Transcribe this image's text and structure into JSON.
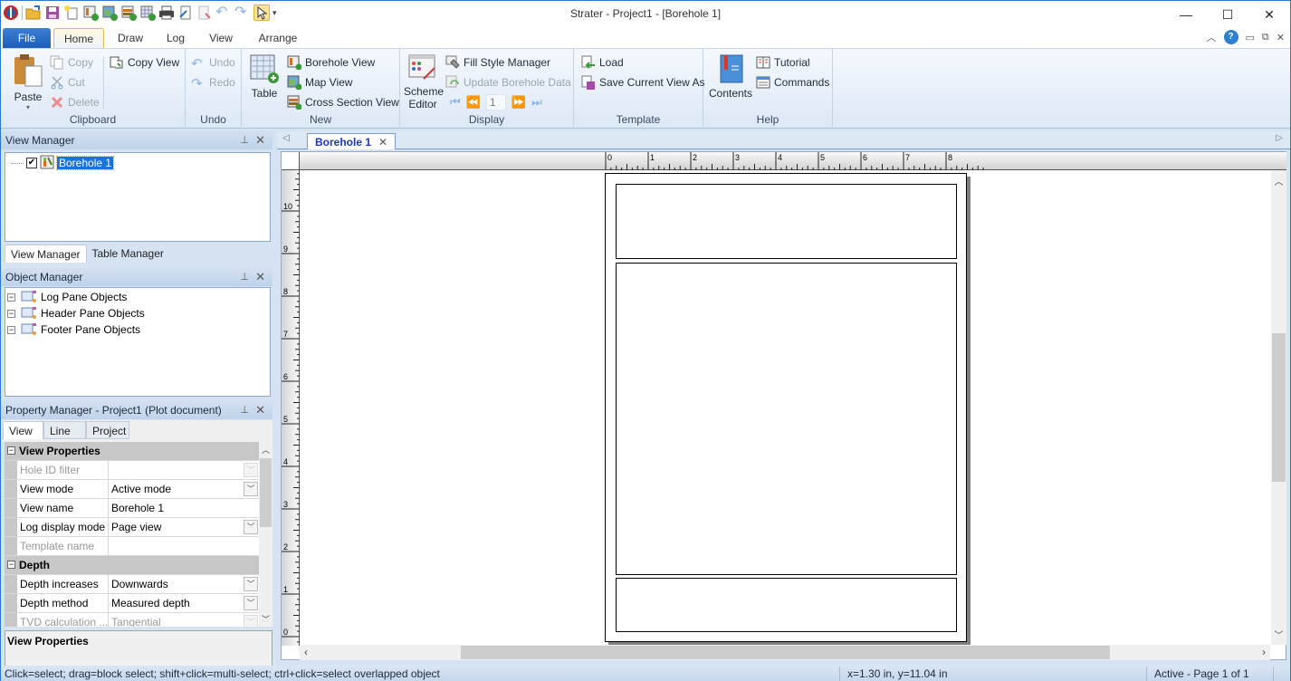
{
  "window": {
    "title": "Strater - Project1 - [Borehole 1]",
    "minimize": "—",
    "maximize": "☐",
    "close": "✕"
  },
  "quick_access": [
    "app-menu",
    "open",
    "save",
    "new",
    "new-borehole-view",
    "new-map-view",
    "new-cross-section-view",
    "new-table",
    "print",
    "export",
    "import",
    "undo",
    "redo",
    "select",
    "customize"
  ],
  "ribbon_tabs": [
    "File",
    "Home",
    "Draw",
    "Log",
    "View",
    "Arrange"
  ],
  "active_ribbon_tab": "Home",
  "mdi": {
    "collapse": "︿",
    "help": "?",
    "minimize": "▭",
    "restore": "⧉",
    "close": "✕"
  },
  "ribbon": {
    "clipboard": {
      "label": "Clipboard",
      "paste": "Paste",
      "copy": "Copy",
      "cut": "Cut",
      "delete": "Delete",
      "copy_view": "Copy View"
    },
    "undo": {
      "label": "Undo",
      "undo": "Undo",
      "redo": "Redo"
    },
    "new": {
      "label": "New",
      "table": "Table",
      "borehole_view": "Borehole View",
      "map_view": "Map View",
      "cross_section_view": "Cross Section View"
    },
    "display": {
      "label": "Display",
      "scheme_editor_1": "Scheme",
      "scheme_editor_2": "Editor",
      "fill_style_manager": "Fill Style Manager",
      "update_borehole_data": "Update Borehole Data",
      "page_value": "1"
    },
    "template": {
      "label": "Template",
      "load": "Load",
      "save_current_view_as": "Save Current View As"
    },
    "help": {
      "label": "Help",
      "contents": "Contents",
      "tutorial": "Tutorial",
      "commands": "Commands"
    }
  },
  "view_manager": {
    "title": "View Manager",
    "items": [
      {
        "label": "Borehole 1",
        "checked": true,
        "selected": true
      }
    ],
    "tabs": [
      "View Manager",
      "Table Manager"
    ]
  },
  "object_manager": {
    "title": "Object Manager",
    "items": [
      "Log Pane Objects",
      "Header Pane Objects",
      "Footer Pane Objects"
    ]
  },
  "property_manager": {
    "title": "Property Manager - Project1 (Plot document)",
    "tabs": [
      "View",
      "Line",
      "Project"
    ],
    "active_tab": "View",
    "sections": [
      {
        "name": "View Properties",
        "rows": [
          {
            "name": "Hole ID filter",
            "value": "",
            "disabled": true,
            "dropdown": true
          },
          {
            "name": "View mode",
            "value": "Active mode",
            "disabled": false,
            "dropdown": true
          },
          {
            "name": "View name",
            "value": "Borehole 1",
            "disabled": false,
            "dropdown": false
          },
          {
            "name": "Log display mode",
            "value": "Page view",
            "disabled": false,
            "dropdown": true
          },
          {
            "name": "Template name",
            "value": "",
            "disabled": true,
            "dropdown": false
          }
        ]
      },
      {
        "name": "Depth",
        "rows": [
          {
            "name": "Depth increases",
            "value": "Downwards",
            "disabled": false,
            "dropdown": true
          },
          {
            "name": "Depth method",
            "value": "Measured depth",
            "disabled": false,
            "dropdown": true
          },
          {
            "name": "TVD calculation ...",
            "value": "Tangential",
            "disabled": true,
            "dropdown": true
          }
        ]
      }
    ],
    "description": "View Properties"
  },
  "document": {
    "tab_label": "Borehole 1",
    "h_ruler_labels": [
      "0",
      "1",
      "2",
      "3",
      "4",
      "5",
      "6",
      "7",
      "8"
    ],
    "v_ruler_labels": [
      "10",
      "9",
      "8",
      "7",
      "6",
      "5",
      "4",
      "3",
      "2",
      "1",
      "0"
    ]
  },
  "status": {
    "hint": "Click=select; drag=block select; shift+click=multi-select; ctrl+click=select overlapped object",
    "coords": "x=1.30 in, y=11.04 in",
    "page": "Active - Page 1 of 1"
  }
}
